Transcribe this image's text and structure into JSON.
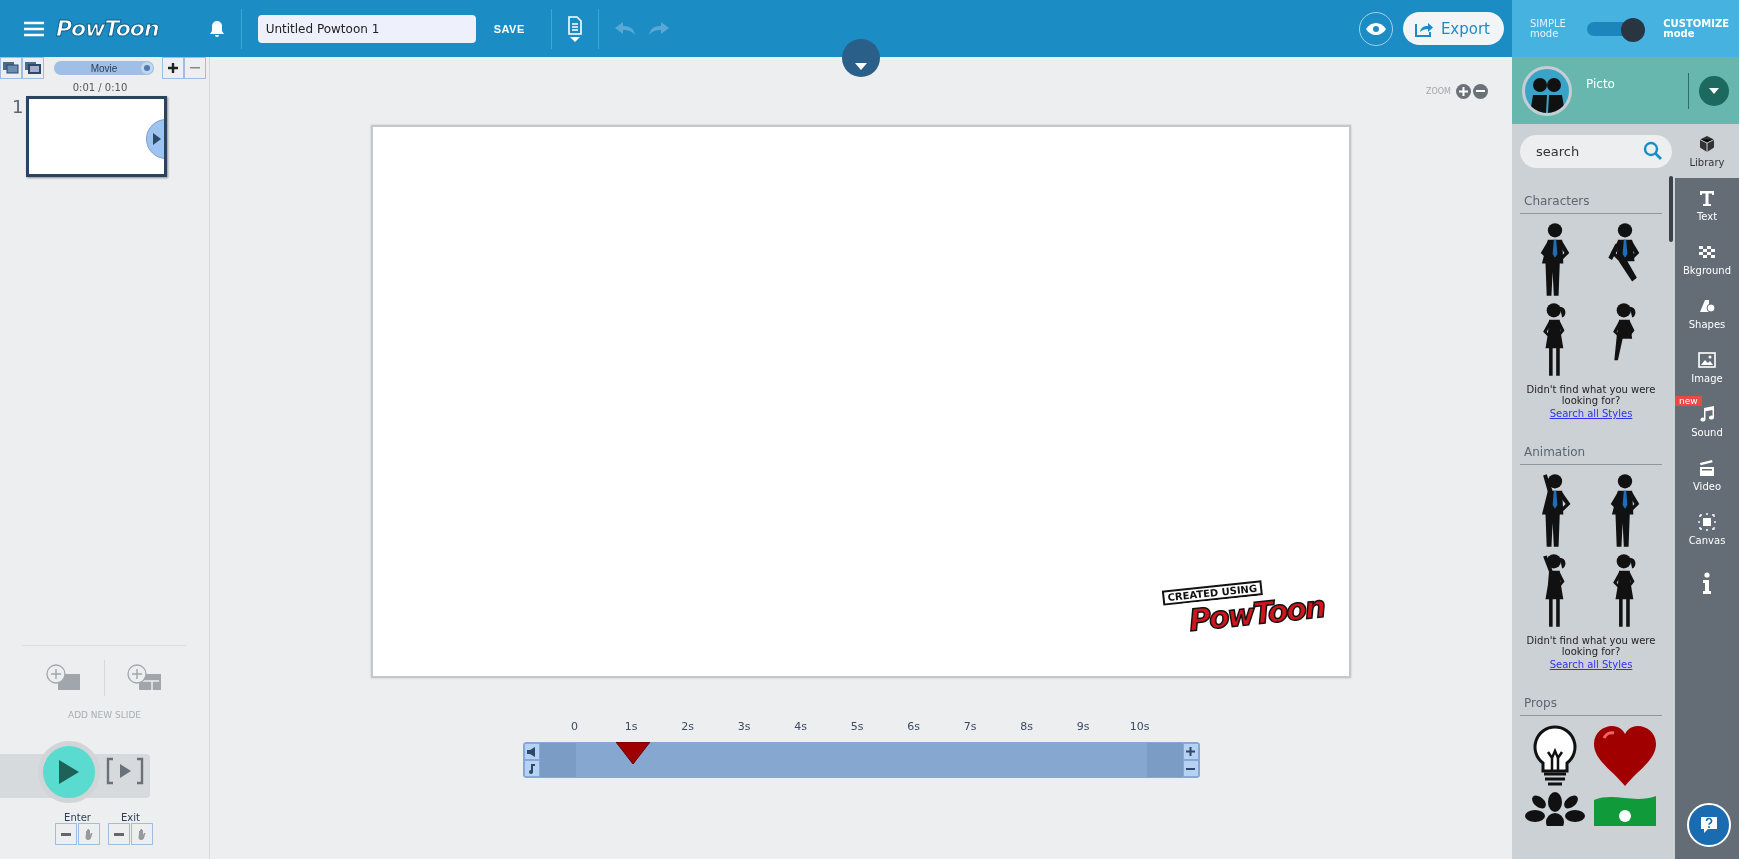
{
  "top_bar": {
    "logo": "PowToon",
    "title_value": "Untitled Powtoon 1",
    "save": "SAVE",
    "export": "Export",
    "mode": {
      "left": "SIMPLE",
      "left_sub": "mode",
      "right": "CUSTOMIZE",
      "right_sub": "mode",
      "customize_on": true
    }
  },
  "slides_panel": {
    "view_mode": "Movie",
    "time": "0:01 / 0:10",
    "slides": [
      {
        "number": "1",
        "selected": true
      }
    ],
    "add_label": "ADD NEW SLIDE",
    "enter": "Enter",
    "exit": "Exit"
  },
  "canvas": {
    "zoom_label": "ZOOM",
    "badge_top": "CREATED USING",
    "badge_logo": "PowToon"
  },
  "timeline": {
    "ticks": [
      "0",
      "1s",
      "2s",
      "3s",
      "4s",
      "5s",
      "6s",
      "7s",
      "8s",
      "9s",
      "10s"
    ],
    "level": 0.1
  },
  "style_panel": {
    "style": "Picto",
    "search_placeholder": "search",
    "sections": [
      {
        "title": "Characters",
        "items": [
          {
            "kind": "man"
          },
          {
            "kind": "man-sitting"
          },
          {
            "kind": "woman"
          },
          {
            "kind": "woman-sitting"
          }
        ],
        "hint": "Didn't find what you were looking for?",
        "link": "Search all Styles"
      },
      {
        "title": "Animation",
        "items": [
          {
            "kind": "man-waving"
          },
          {
            "kind": "man"
          },
          {
            "kind": "woman-waving"
          },
          {
            "kind": "woman"
          }
        ],
        "hint": "Didn't find what you were looking for?",
        "link": "Search all Styles"
      },
      {
        "title": "Props",
        "items": [
          {
            "kind": "bulb"
          },
          {
            "kind": "heart"
          },
          {
            "kind": "flower"
          },
          {
            "kind": "flag"
          }
        ]
      }
    ]
  },
  "tool_rail": [
    {
      "kind": "box",
      "label": "Library",
      "selected": true
    },
    {
      "kind": "text",
      "label": "Text",
      "selected": false
    },
    {
      "kind": "checker",
      "label": "Bkground",
      "selected": false
    },
    {
      "kind": "shapes",
      "label": "Shapes",
      "selected": false
    },
    {
      "kind": "image",
      "label": "Image",
      "selected": false
    },
    {
      "kind": "note",
      "label": "Sound",
      "selected": false,
      "badge": "new"
    },
    {
      "kind": "clapper",
      "label": "Video",
      "selected": false
    },
    {
      "kind": "canvas",
      "label": "Canvas",
      "selected": false
    },
    {
      "kind": "info",
      "selected": false
    }
  ]
}
